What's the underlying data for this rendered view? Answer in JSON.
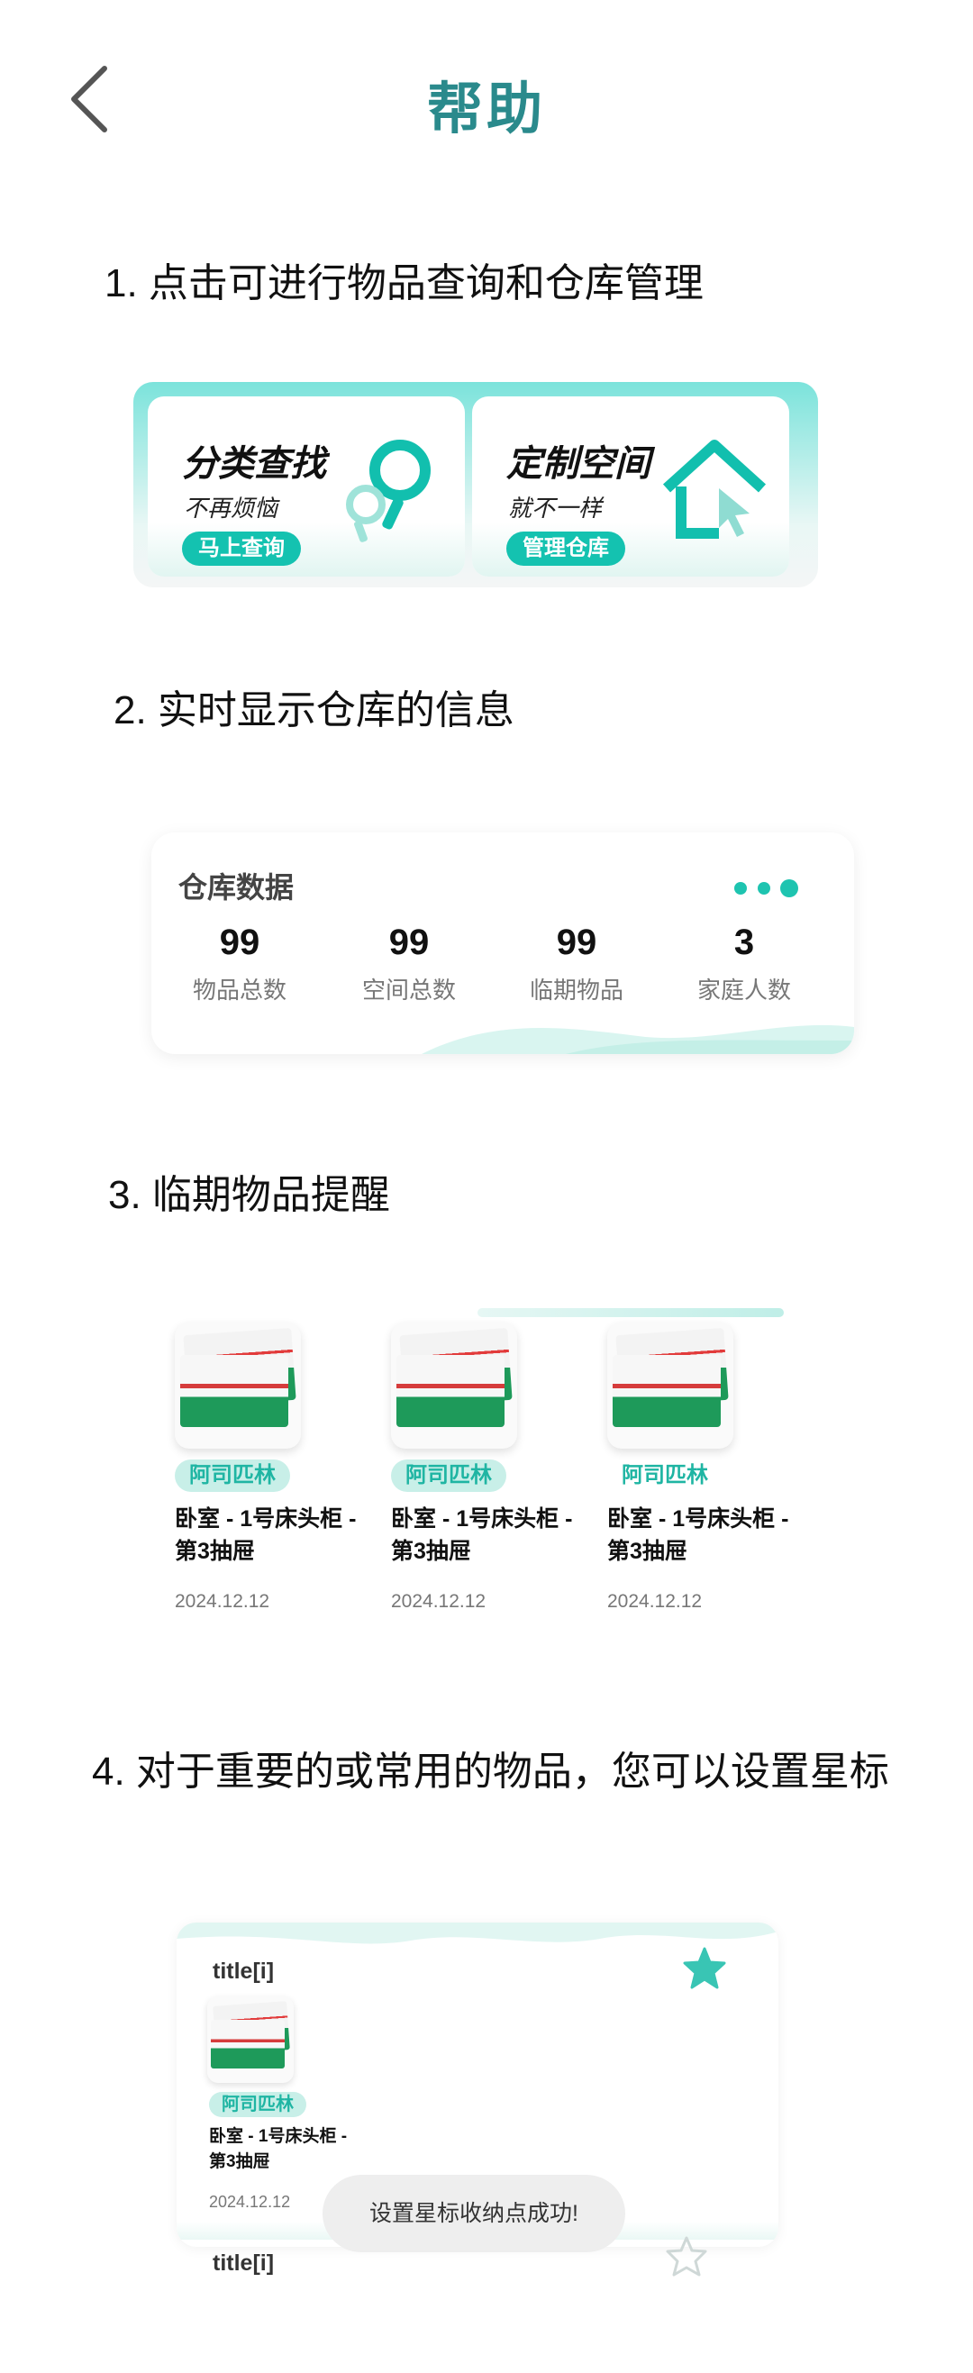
{
  "header": {
    "title": "帮助",
    "back_icon": "chevron-left-icon"
  },
  "steps": [
    "1. 点击可进行物品查询和仓库管理",
    "2. 实时显示仓库的信息",
    "3. 临期物品提醒",
    "4. 对于重要的或常用的物品，您可以设置星标"
  ],
  "section1": {
    "tiles": [
      {
        "title": "分类查找",
        "subtitle": "不再烦恼",
        "button": "马上查询",
        "icon": "magnifier-icon"
      },
      {
        "title": "定制空间",
        "subtitle": "就不一样",
        "button": "管理仓库",
        "icon": "house-cursor-icon"
      }
    ]
  },
  "section2": {
    "title": "仓库数据",
    "stats": [
      {
        "value": "99",
        "label": "物品总数"
      },
      {
        "value": "99",
        "label": "空间总数"
      },
      {
        "value": "99",
        "label": "临期物品"
      },
      {
        "value": "3",
        "label": "家庭人数"
      }
    ]
  },
  "section3": {
    "items": [
      {
        "name": "阿司匹林",
        "location": "卧室 - 1号床头柜 -\n第3抽屉",
        "date": "2024.12.12"
      },
      {
        "name": "阿司匹林",
        "location": "卧室 - 1号床头柜 -\n第3抽屉",
        "date": "2024.12.12"
      },
      {
        "name": "阿司匹林",
        "location": "卧室 - 1号床头柜 -\n第3抽屉",
        "date": "2024.12.12"
      }
    ]
  },
  "section4": {
    "card1_title": "title[i]",
    "card2_title": "title[i]",
    "item": {
      "name": "阿司匹林",
      "location": "卧室 - 1号床头柜 -\n第3抽屉",
      "date": "2024.12.12"
    },
    "toast": "设置星标收纳点成功!"
  },
  "colors": {
    "accent": "#14c2b0",
    "title": "#2a8a8c",
    "tag_bg": "#c8efe8"
  }
}
